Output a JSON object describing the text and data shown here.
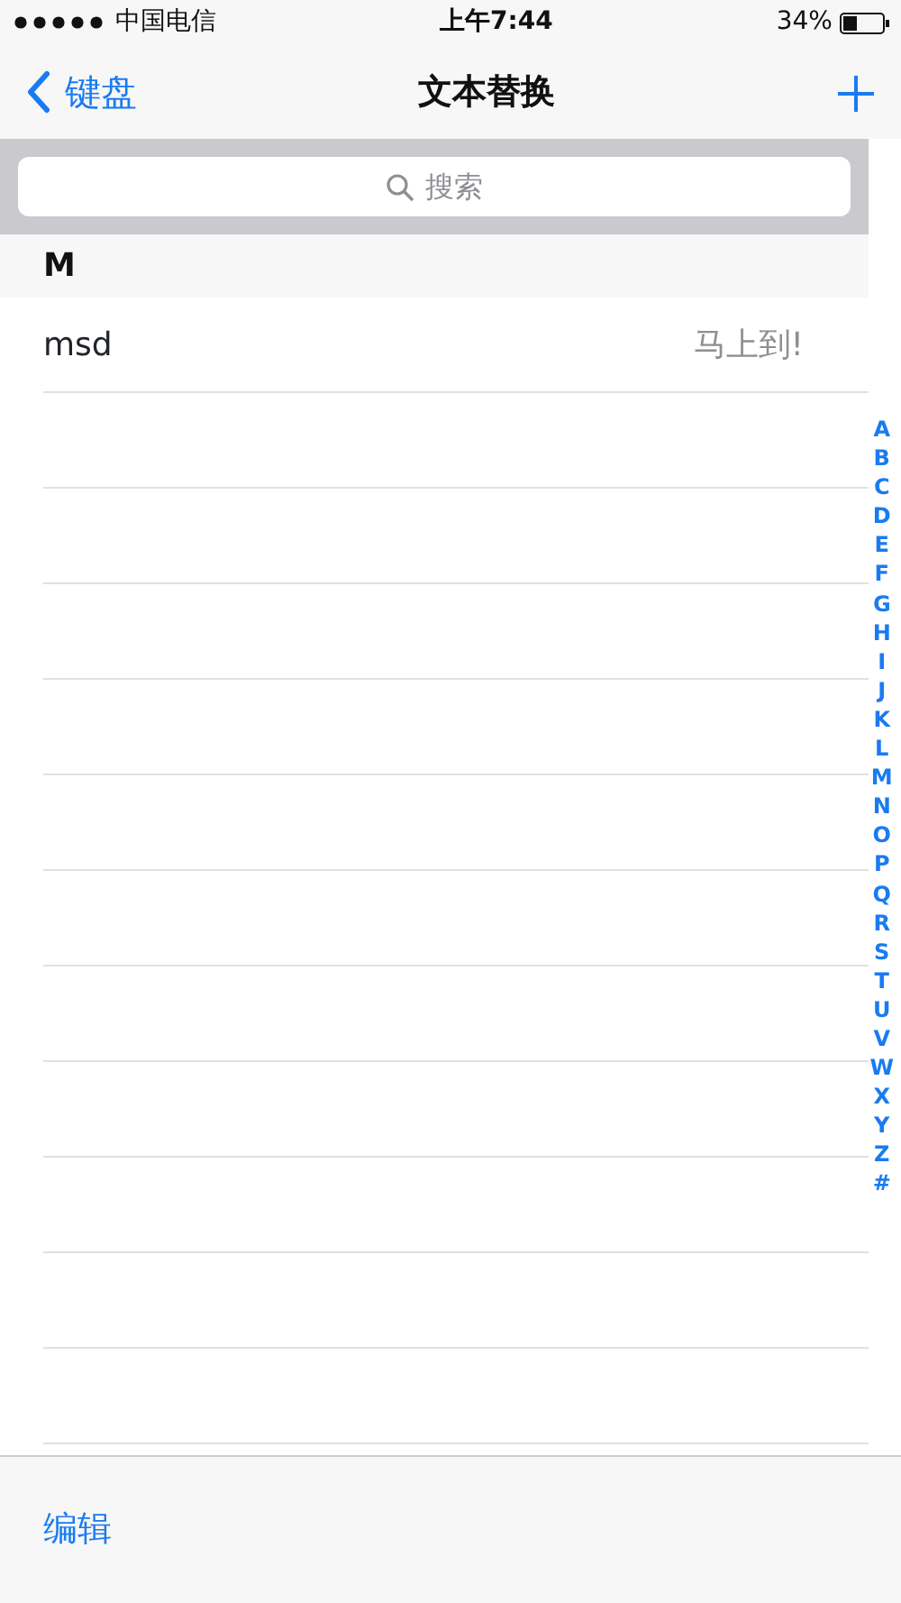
{
  "status_bar": {
    "carrier": "中国电信",
    "time": "上午7:44",
    "battery_percent": "34%"
  },
  "nav_bar": {
    "back_label": "键盘",
    "title": "文本替换"
  },
  "search": {
    "placeholder": "搜索"
  },
  "sections": [
    {
      "header": "M",
      "rows": [
        {
          "phrase": "msd",
          "shortcut": "马上到!"
        }
      ]
    }
  ],
  "index_letters": [
    "A",
    "B",
    "C",
    "D",
    "E",
    "F",
    "G",
    "H",
    "I",
    "J",
    "K",
    "L",
    "M",
    "N",
    "O",
    "P",
    "Q",
    "R",
    "S",
    "T",
    "U",
    "V",
    "W",
    "X",
    "Y",
    "Z",
    "#"
  ],
  "toolbar": {
    "edit_label": "编辑"
  }
}
